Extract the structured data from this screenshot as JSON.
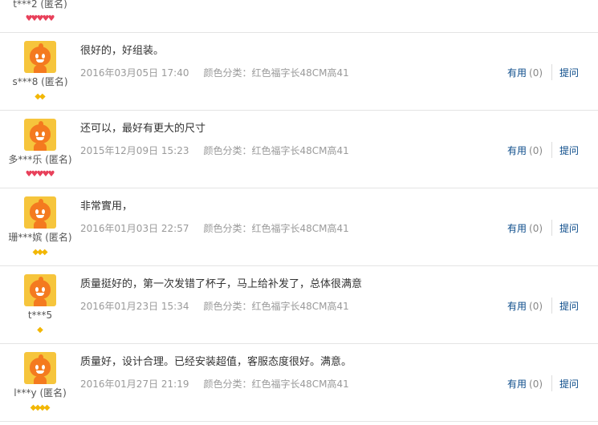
{
  "reviews": [
    {
      "user": "t***2 (匿名)",
      "badge_type": "heart",
      "badge_count": 5,
      "partial": true
    },
    {
      "user": "s***8 (匿名)",
      "badge_type": "diamond",
      "badge_count": 2,
      "content": "很好的，好组装。",
      "date": "2016年03月05日 17:40",
      "spec": "颜色分类：红色福字长48CM高41",
      "useful_label": "有用",
      "useful_count": "(0)",
      "ask_label": "提问"
    },
    {
      "user": "多***乐 (匿名)",
      "badge_type": "heart",
      "badge_count": 5,
      "content": "还可以，最好有更大的尺寸",
      "date": "2015年12月09日 15:23",
      "spec": "颜色分类：红色福字长48CM高41",
      "useful_label": "有用",
      "useful_count": "(0)",
      "ask_label": "提问"
    },
    {
      "user": "珊***嫔 (匿名)",
      "badge_type": "diamond",
      "badge_count": 3,
      "content": "非常實用，",
      "date": "2016年01月03日 22:57",
      "spec": "颜色分类：红色福字长48CM高41",
      "useful_label": "有用",
      "useful_count": "(0)",
      "ask_label": "提问"
    },
    {
      "user": "t***5",
      "badge_type": "diamond",
      "badge_count": 1,
      "content": "质量挺好的，第一次发错了杯子，马上给补发了，总体很满意",
      "date": "2016年01月23日 15:34",
      "spec": "颜色分类：红色福字长48CM高41",
      "useful_label": "有用",
      "useful_count": "(0)",
      "ask_label": "提问"
    },
    {
      "user": "l***y (匿名)",
      "badge_type": "diamond",
      "badge_count": 4,
      "content": "质量好，设计合理。已经安装超值，客服态度很好。满意。",
      "date": "2016年01月27日 21:19",
      "spec": "颜色分类：红色福字长48CM高41",
      "useful_label": "有用",
      "useful_count": "(0)",
      "ask_label": "提问"
    }
  ]
}
